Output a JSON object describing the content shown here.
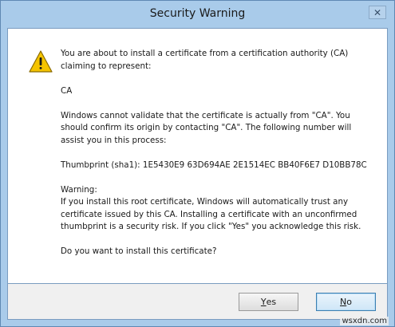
{
  "window": {
    "title": "Security Warning",
    "close_symbol": "✕",
    "close_icon": "close-icon"
  },
  "message": {
    "icon": "warning-icon",
    "intro": "You are about to install a certificate from a certification authority (CA) claiming to represent:",
    "ca_name": "CA",
    "validation": "Windows cannot validate that the certificate is actually from \"CA\". You should confirm its origin by contacting \"CA\". The following number will assist you in this process:",
    "thumbprint": "Thumbprint (sha1): 1E5430E9 63D694AE 2E1514EC BB40F6E7 D10BB78C",
    "warning_heading": "Warning:",
    "warning_text": "If you install this root certificate, Windows will automatically trust any certificate issued by this CA. Installing a certificate with an unconfirmed thumbprint is a security risk. If you click \"Yes\" you acknowledge this risk.",
    "question": "Do you want to install this certificate?"
  },
  "buttons": {
    "yes_access_key": "Y",
    "yes_rest": "es",
    "no_access_key": "N",
    "no_rest": "o"
  },
  "watermark": "wsxdn.com",
  "colors": {
    "titlebar": "#a9cbea",
    "warning_yellow": "#f5c400"
  }
}
